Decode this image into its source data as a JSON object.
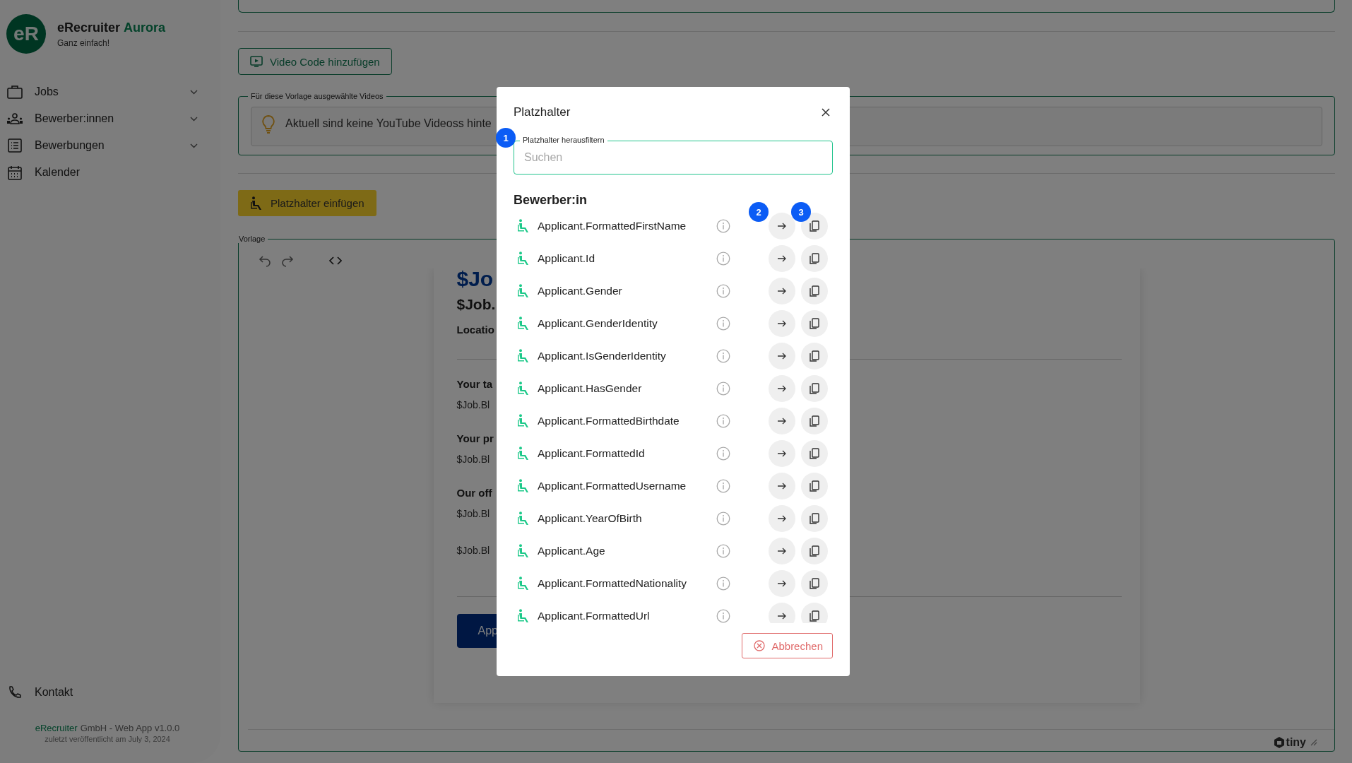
{
  "sidebar": {
    "logo": "eR",
    "brand": "eRecruiter",
    "edition": "Aurora",
    "tagline": "Ganz einfach!",
    "items": [
      {
        "kind": "briefcase",
        "label": "Jobs",
        "expandable": true
      },
      {
        "kind": "people",
        "label": "Bewerber:innen",
        "expandable": true
      },
      {
        "kind": "list",
        "label": "Bewerbungen",
        "expandable": true
      },
      {
        "kind": "calendar",
        "label": "Kalender",
        "expandable": false
      }
    ],
    "contact": {
      "kind": "phone",
      "label": "Kontakt"
    },
    "footer": {
      "company": "eRecruiter",
      "version": "GmbH - Web App v1.0.0",
      "published": "zuletzt veröffentlicht am July 3, 2024"
    }
  },
  "editor": {
    "video_button": "Video Code hinzufügen",
    "videos_legend": "Für diese Vorlage ausgewählte Videos",
    "videos_notice": "Aktuell sind keine YouTube Videoss hinte",
    "insert_button": "Platzhalter einfügen",
    "template_legend": "Vorlage",
    "document": [
      {
        "kind": "title",
        "text": "$Jo"
      },
      {
        "kind": "heading",
        "text": "$Job."
      },
      {
        "kind": "label",
        "text": "Locatio"
      },
      {
        "kind": "rule"
      },
      {
        "kind": "section",
        "text": "Your ta"
      },
      {
        "kind": "body",
        "text": "$Job.Bl"
      },
      {
        "kind": "section",
        "text": "Your pr"
      },
      {
        "kind": "body",
        "text": "$Job.Bl"
      },
      {
        "kind": "section",
        "text": "Our off"
      },
      {
        "kind": "body",
        "text": "$Job.Bl"
      },
      {
        "kind": "body",
        "text": "$Job.Bl"
      },
      {
        "kind": "rule"
      },
      {
        "kind": "button",
        "text": "App"
      }
    ],
    "brand": "tiny"
  },
  "dialog": {
    "title": "Platzhalter",
    "filter": {
      "label": "Platzhalter herausfiltern",
      "placeholder": "Suchen",
      "marker": "1"
    },
    "section": "Bewerber:in",
    "rows": [
      {
        "name": "Applicant.FormattedFirstName",
        "insert_marker": "2",
        "copy_marker": "3"
      },
      {
        "name": "Applicant.Id"
      },
      {
        "name": "Applicant.Gender"
      },
      {
        "name": "Applicant.GenderIdentity"
      },
      {
        "name": "Applicant.IsGenderIdentity"
      },
      {
        "name": "Applicant.HasGender"
      },
      {
        "name": "Applicant.FormattedBirthdate"
      },
      {
        "name": "Applicant.FormattedId"
      },
      {
        "name": "Applicant.FormattedUsername"
      },
      {
        "name": "Applicant.YearOfBirth"
      },
      {
        "name": "Applicant.Age"
      },
      {
        "name": "Applicant.FormattedNationality"
      },
      {
        "name": "Applicant.FormattedUrl"
      }
    ],
    "cancel_button": "Abbrechen"
  }
}
